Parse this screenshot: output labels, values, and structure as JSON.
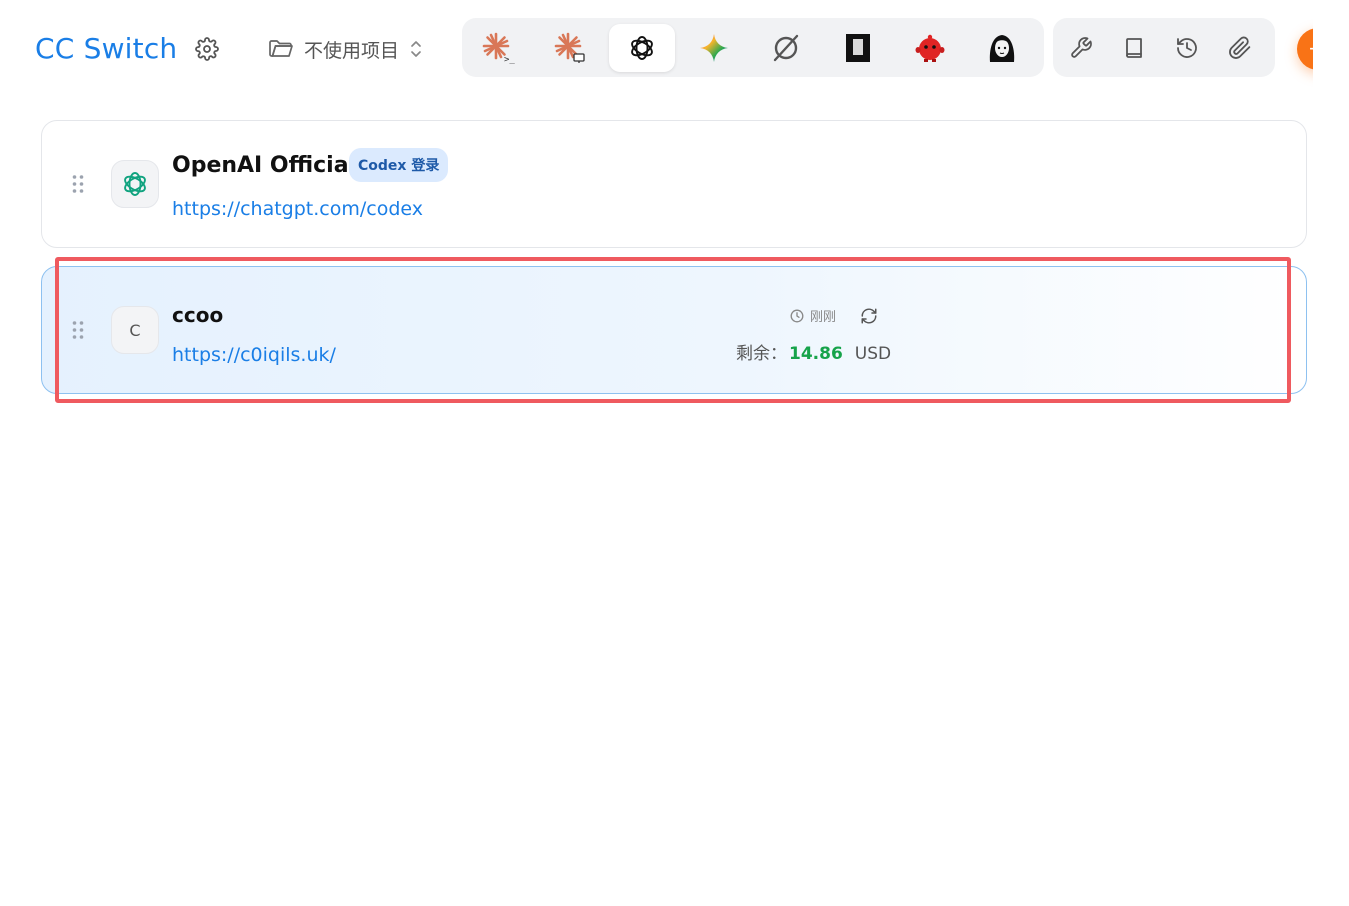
{
  "app": {
    "title": "CC Switch"
  },
  "header": {
    "settings_icon": "gear-icon",
    "project_select": {
      "value": "不使用项目",
      "icon": "folder-icon",
      "chevron": "chevron-updown-icon"
    },
    "tools": [
      {
        "name": "claude-code",
        "icon": "claude-terminal-icon",
        "active": false
      },
      {
        "name": "claude-desktop",
        "icon": "claude-desktop-icon",
        "active": false
      },
      {
        "name": "codex",
        "icon": "openai-icon",
        "active": true
      },
      {
        "name": "gemini",
        "icon": "gemini-icon",
        "active": false
      },
      {
        "name": "opencode",
        "icon": "opencode-icon",
        "active": false
      },
      {
        "name": "terminal",
        "icon": "terminal-block-icon",
        "active": false
      },
      {
        "name": "red-bot",
        "icon": "red-bot-icon",
        "active": false
      },
      {
        "name": "avatar-girl",
        "icon": "girl-portrait-icon",
        "active": false
      }
    ],
    "actions": [
      {
        "name": "tools",
        "icon": "wrench-icon"
      },
      {
        "name": "docs",
        "icon": "book-icon"
      },
      {
        "name": "history",
        "icon": "history-icon"
      },
      {
        "name": "attachments",
        "icon": "paperclip-icon"
      }
    ],
    "add_button": {
      "icon": "plus-icon",
      "label": "+",
      "color": "#f97316"
    }
  },
  "providers": [
    {
      "name": "OpenAI Official",
      "badge": "Codex 登录",
      "url": "https://chatgpt.com/codex",
      "icon": "openai-icon"
    },
    {
      "name": "ccoo",
      "avatar_letter": "C",
      "url": "https://c0iqils.uk/",
      "usage": {
        "updated": "刚刚",
        "balance_label": "剩余：",
        "balance": "14.86",
        "currency": "USD"
      },
      "selected": true
    }
  ],
  "colors": {
    "accent": "#1a7ee6",
    "balance_positive": "#16a34a",
    "highlight": "#ef5a5f"
  }
}
